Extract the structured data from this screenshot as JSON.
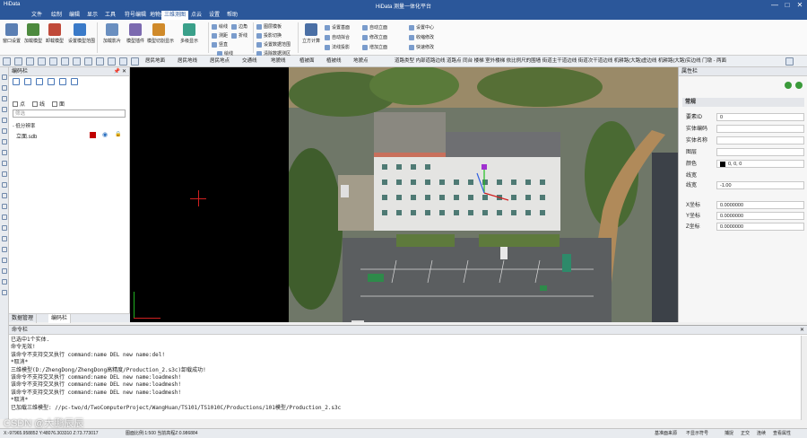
{
  "titlebar": {
    "app": "HiData",
    "title": "HiData 测量一体化平台",
    "minimize": "—",
    "maximize": "□",
    "close": "✕"
  },
  "menu": [
    "文件",
    "绘制",
    "编辑",
    "显示",
    "工具",
    "符号编辑",
    "地物处理",
    "三维测图",
    "点云",
    "设置",
    "帮助"
  ],
  "menu_active_index": 7,
  "ribbon": {
    "big_buttons": [
      "窗口设置",
      "加载模型",
      "卸载模型",
      "设置模型范围",
      "加载影片",
      "模型插件",
      "模型切割显示",
      "多级显示"
    ],
    "small_col1": [
      "绘线",
      "测距",
      "竖直",
      "边角",
      "折线"
    ],
    "small_col2": [
      "绘线",
      "图层模板",
      "投影切换"
    ],
    "small_col3": [
      "设置数据范围",
      "清除数据测区",
      "清除数据测区"
    ],
    "solid": "立方计算",
    "small_col4": [
      "设置基面",
      "自动拟合",
      "法线投影"
    ],
    "small_col5": [
      "自动立面",
      "修改立面",
      "增加立面"
    ],
    "small_col6": [
      "设置中心",
      "收缩修改",
      "快速修改"
    ]
  },
  "toolbar_labels": [
    "居民地面",
    "居民地线",
    "居民地点",
    "交通线",
    "地貌线",
    "植被面",
    "植被线",
    "地貌点"
  ],
  "toolbar_strip": "道路类型 内部道路边线 道路点 同台 楼梯 室外楼梯 依比例尺的围墙 街道主干道边线 街道次干道边线 机耕路(大路)虚边线 机耕路(大路)实边线 门墩 - 两面",
  "left_panel": {
    "title": "编码栏",
    "pin": "📌 ✕",
    "checkboxes": [
      "点",
      "线",
      "面"
    ],
    "filter_placeholder": "筛选",
    "tree_root": "- 低分辨率",
    "layer_name": "立面.sdb",
    "tabs": [
      "数据管理",
      "编码栏"
    ]
  },
  "props": {
    "title": "属性栏",
    "section": "常规",
    "rows": [
      {
        "k": "要素ID",
        "v": "0"
      },
      {
        "k": "实体编码",
        "v": ""
      },
      {
        "k": "实体名称",
        "v": ""
      },
      {
        "k": "图层",
        "v": ""
      },
      {
        "k": "颜色",
        "v": "0, 0, 0"
      },
      {
        "k": "线宽",
        "v": ""
      },
      {
        "k": "线宽",
        "v": "-1.00"
      },
      {
        "k": "X坐标",
        "v": "0.0000000"
      },
      {
        "k": "Y坐标",
        "v": "0.0000000"
      },
      {
        "k": "Z坐标",
        "v": "0.0000000"
      }
    ]
  },
  "cmd": {
    "title": "命令栏",
    "lines": [
      "已选中1个实体.",
      "命令无效!",
      "该命令不支持交叉执行 command:name DEL new name:del!",
      "*取消*",
      "三维模型(D:/ZhengDong/ZhengDong高精度/Production_2.s3c)卸载成功!",
      "该命令不支持交叉执行 command:name DEL new name:loadmesh!",
      "该命令不支持交叉执行 command:name DEL new name:loadmesh!",
      "该命令不支持交叉执行 command:name DEL new name:loadmesh!",
      "*取消*",
      "已加载三维模型: //pc-two/d/TwoComputerProject/WangHuan/TS101/TS1010C/Productions/101模型/Production_2.s3c"
    ]
  },
  "status": {
    "coords": "X:-97965.958852 Y:48076.303310 Z:73.773017",
    "scale": "图面比例:1:500  当前高程Z:0.986884",
    "right": [
      "基准面来源",
      "不显示符号",
      "捕捉",
      "正交",
      "连续",
      "查看属性"
    ]
  },
  "watermark": "CSDN @大鹏辰辰",
  "colors": {
    "title_bg": "#2b579a",
    "layer_color": "#c00000",
    "props_swatch": "#000000"
  }
}
